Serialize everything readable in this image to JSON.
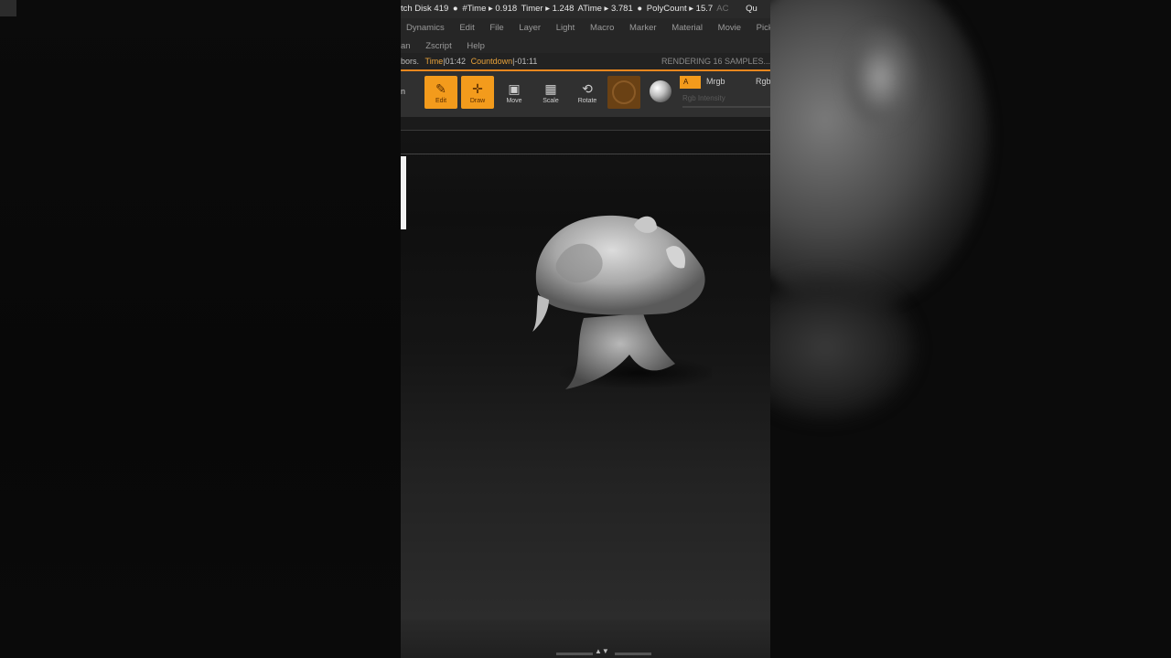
{
  "statusbar": {
    "items": [
      "tch Disk 419",
      "#Time ▸ 0.918",
      "Timer ▸ 1.248",
      "ATime ▸ 3.781",
      "PolyCount ▸ 15.7"
    ],
    "trail_dim": "AC",
    "trail": "Qu"
  },
  "menu": {
    "row1": [
      "Dynamics",
      "Edit",
      "File",
      "Layer",
      "Light",
      "Macro",
      "Marker",
      "Material",
      "Movie",
      "Pick"
    ],
    "row2_left": "an",
    "row2": [
      "Zscript",
      "Help"
    ]
  },
  "notebar": {
    "left": "bors.",
    "time_label": "Time",
    "time_value": "|01:42",
    "countdown_label": "Countdown",
    "countdown_value": "|-01:11",
    "rendering": "RENDERING 16 SAMPLES..."
  },
  "toolbar": {
    "nav_left": "n",
    "edit": "Edit",
    "draw": "Draw",
    "move": "Move",
    "scale": "Scale",
    "rotate": "Rotate",
    "a_button": "A",
    "mrgb": "Mrgb",
    "rgb": "Rgb",
    "rgb_intensity": "Rgb Intensity"
  },
  "colors": {
    "accent": "#f39b1c",
    "background": "#1b1b1b",
    "viewport": "#141414"
  },
  "icons": [
    "edit-icon",
    "draw-icon",
    "move-icon",
    "scale-icon",
    "rotate-icon",
    "material-sphere-icon",
    "nav-arrows-icon"
  ]
}
